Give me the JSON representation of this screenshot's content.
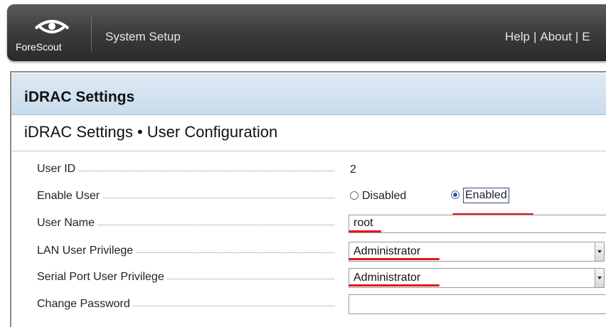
{
  "header": {
    "logo_text": "ForeScout",
    "app_title": "System Setup",
    "links": [
      "Help",
      "About",
      "E"
    ],
    "link_separator": "|"
  },
  "section": {
    "title": "iDRAC Settings"
  },
  "page": {
    "title": "iDRAC Settings • User Configuration"
  },
  "form": {
    "user_id": {
      "label": "User ID",
      "value": "2"
    },
    "enable_user": {
      "label": "Enable User",
      "options": [
        "Disabled",
        "Enabled"
      ],
      "selected": "Enabled"
    },
    "user_name": {
      "label": "User Name",
      "value": "root"
    },
    "lan_privilege": {
      "label": "LAN User Privilege",
      "value": "Administrator"
    },
    "serial_privilege": {
      "label": "Serial Port User Privilege",
      "value": "Administrator"
    },
    "change_password": {
      "label": "Change Password",
      "value": ""
    }
  },
  "colors": {
    "annotation_red": "#e2161b",
    "section_header_blue": "#c9dcec",
    "header_dark": "#2a2a2a"
  }
}
